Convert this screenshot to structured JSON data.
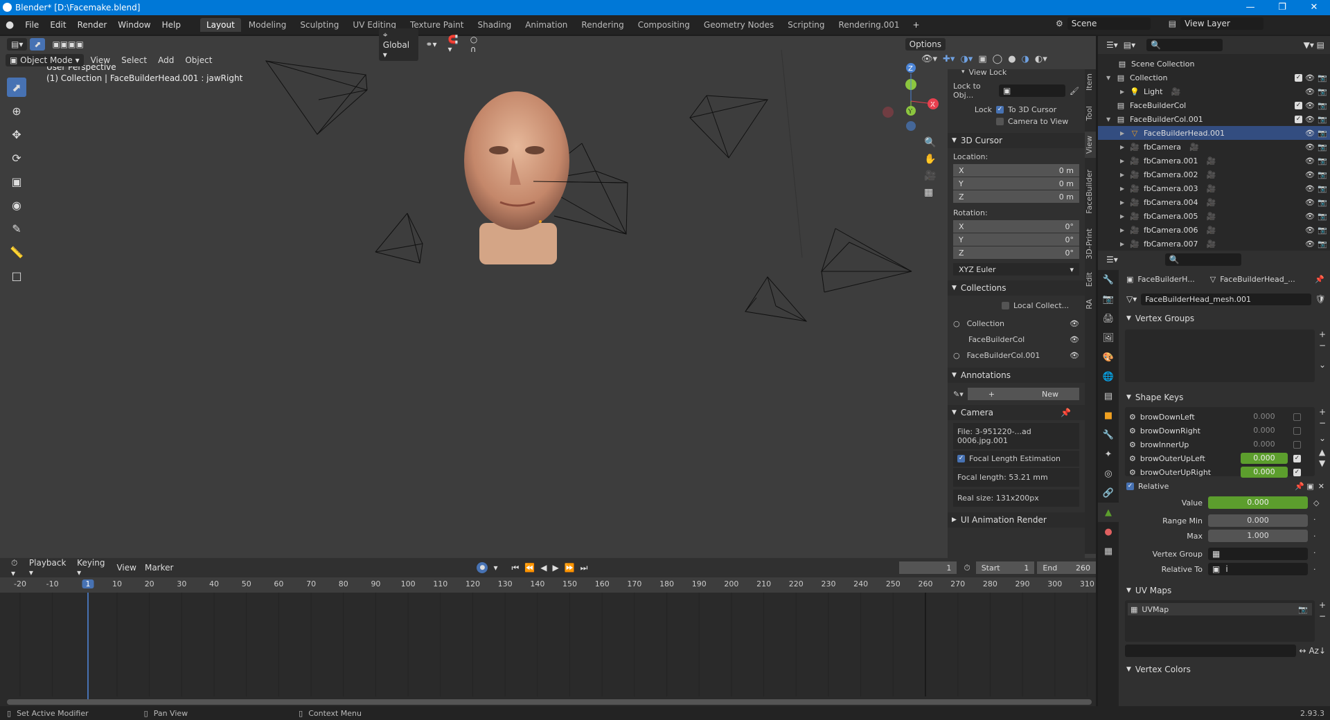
{
  "window": {
    "title": "Blender* [D:\\Facemake.blend]"
  },
  "menu": [
    "File",
    "Edit",
    "Render",
    "Window",
    "Help"
  ],
  "workspaces": [
    "Layout",
    "Modeling",
    "Sculpting",
    "UV Editing",
    "Texture Paint",
    "Shading",
    "Animation",
    "Rendering",
    "Compositing",
    "Geometry Nodes",
    "Scripting",
    "Rendering.001"
  ],
  "scene": {
    "label": "Scene",
    "view_layer": "View Layer"
  },
  "viewport": {
    "mode": "Object Mode",
    "menus": [
      "View",
      "Select",
      "Add",
      "Object"
    ],
    "orientation": "Global",
    "options": "Options",
    "overlay_title": "User Perspective",
    "overlay_sub": "(1) Collection | FaceBuilderHead.001 : jawRight"
  },
  "npanel": {
    "view_lock": "View Lock",
    "lock_to_obj": "Lock to Obj...",
    "lock_label": "Lock",
    "to_3d_cursor": "To 3D Cursor",
    "camera_to_view": "Camera to View",
    "cursor_title": "3D Cursor",
    "location_label": "Location:",
    "loc": [
      {
        "axis": "X",
        "val": "0 m"
      },
      {
        "axis": "Y",
        "val": "0 m"
      },
      {
        "axis": "Z",
        "val": "0 m"
      }
    ],
    "rotation_label": "Rotation:",
    "rot": [
      {
        "axis": "X",
        "val": "0°"
      },
      {
        "axis": "Y",
        "val": "0°"
      },
      {
        "axis": "Z",
        "val": "0°"
      }
    ],
    "rot_mode": "XYZ Euler",
    "collections_title": "Collections",
    "local_collect": "Local Collect...",
    "collections": [
      "Collection",
      "FaceBuilderCol",
      "FaceBuilderCol.001"
    ],
    "annotations_title": "Annotations",
    "new_label": "New",
    "camera_title": "Camera",
    "file_info": "File: 3-951220-...ad 0006.jpg.001",
    "focal_estimation": "Focal Length Estimation",
    "focal_length": "Focal length: 53.21 mm",
    "real_size": "Real size: 131x200px",
    "ui_anim_title": "UI Animation Render",
    "tabs": [
      "Item",
      "Tool",
      "View",
      "FaceBuilder",
      "3D-Print",
      "Edit",
      "RA"
    ]
  },
  "outliner": {
    "root": "Scene Collection",
    "items": [
      {
        "label": "Collection",
        "depth": 1,
        "icon": "collection",
        "check": true
      },
      {
        "label": "Light",
        "depth": 2,
        "icon": "light"
      },
      {
        "label": "FaceBuilderCol",
        "depth": 1,
        "icon": "collection",
        "check": true
      },
      {
        "label": "FaceBuilderCol.001",
        "depth": 1,
        "icon": "collection",
        "check": true
      },
      {
        "label": "FaceBuilderHead.001",
        "depth": 2,
        "icon": "mesh"
      },
      {
        "label": "fbCamera",
        "depth": 2,
        "icon": "camera"
      },
      {
        "label": "fbCamera.001",
        "depth": 2,
        "icon": "camera"
      },
      {
        "label": "fbCamera.002",
        "depth": 2,
        "icon": "camera"
      },
      {
        "label": "fbCamera.003",
        "depth": 2,
        "icon": "camera"
      },
      {
        "label": "fbCamera.004",
        "depth": 2,
        "icon": "camera"
      },
      {
        "label": "fbCamera.005",
        "depth": 2,
        "icon": "camera"
      },
      {
        "label": "fbCamera.006",
        "depth": 2,
        "icon": "camera"
      },
      {
        "label": "fbCamera.007",
        "depth": 2,
        "icon": "camera"
      }
    ]
  },
  "properties": {
    "obj_name": "FaceBuilderH...",
    "mesh_name_short": "FaceBuilderHead_...",
    "mesh_name": "FaceBuilderHead_mesh.001",
    "vertex_groups": "Vertex Groups",
    "shape_keys": "Shape Keys",
    "keys": [
      {
        "name": "browDownLeft",
        "value": "0.000",
        "active": false
      },
      {
        "name": "browDownRight",
        "value": "0.000",
        "active": false
      },
      {
        "name": "browInnerUp",
        "value": "0.000",
        "active": false
      },
      {
        "name": "browOuterUpLeft",
        "value": "0.000",
        "active": true
      },
      {
        "name": "browOuterUpRight",
        "value": "0.000",
        "active": true
      }
    ],
    "relative": "Relative",
    "value_label": "Value",
    "value": "0.000",
    "range_min_label": "Range Min",
    "range_min": "0.000",
    "max_label": "Max",
    "max": "1.000",
    "vertex_group_label": "Vertex Group",
    "relative_to_label": "Relative To",
    "relative_to": "i",
    "uv_maps": "UV Maps",
    "uvmap": "UVMap",
    "vertex_colors": "Vertex Colors"
  },
  "timeline": {
    "menus": [
      "Playback",
      "Keying",
      "View",
      "Marker"
    ],
    "current_frame": "1",
    "start_label": "Start",
    "start": "1",
    "end_label": "End",
    "end": "260",
    "ticks": [
      "-20",
      "-10",
      "1",
      "10",
      "20",
      "30",
      "40",
      "50",
      "60",
      "70",
      "80",
      "90",
      "100",
      "110",
      "120",
      "130",
      "140",
      "150",
      "160",
      "170",
      "180",
      "190",
      "200",
      "210",
      "220",
      "230",
      "240",
      "250",
      "260",
      "270",
      "280",
      "290",
      "300",
      "310"
    ]
  },
  "status": {
    "left": "Set Active Modifier",
    "mid": "Pan View",
    "right": "Context Menu",
    "version": "2.93.3"
  },
  "colors": {
    "accent": "#4772b3",
    "green": "#5c9e2d",
    "titlebar": "#0078d7"
  }
}
